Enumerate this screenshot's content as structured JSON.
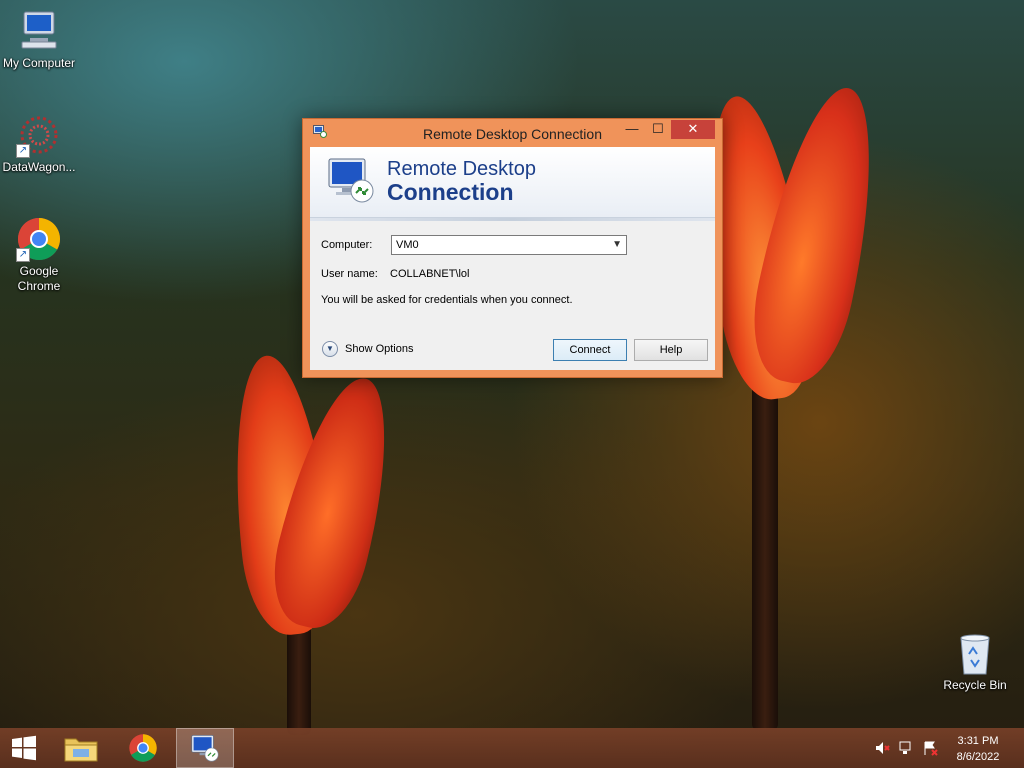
{
  "desktop": {
    "icons": [
      {
        "label": "My Computer"
      },
      {
        "label": "DataWagon..."
      },
      {
        "label": "Google Chrome"
      },
      {
        "label": "Recycle Bin"
      }
    ]
  },
  "window": {
    "title": "Remote Desktop Connection",
    "controls": {
      "minimize": "—",
      "maximize": "☐",
      "close": "✕"
    },
    "banner": {
      "line1": "Remote Desktop",
      "line2": "Connection"
    },
    "computer_label": "Computer:",
    "computer_value": "VM0",
    "username_label": "User name:",
    "username_value": "COLLABNET\\lol",
    "info_text": "You will be asked for credentials when you connect.",
    "show_options_label": "Show Options",
    "connect_label": "Connect",
    "help_label": "Help"
  },
  "taskbar": {
    "items": [
      "start-button",
      "file-explorer",
      "google-chrome",
      "remote-desktop-connection"
    ],
    "clock_time": "3:31 PM",
    "clock_date": "8/6/2022"
  },
  "colors": {
    "window_frame": "#f0935a",
    "close_button": "#c7423a",
    "banner_text": "#1c3f8a",
    "taskbar": "#6e3a24"
  }
}
